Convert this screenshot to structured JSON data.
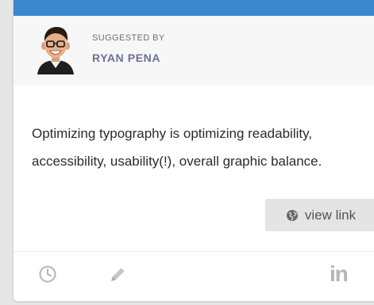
{
  "card": {
    "suggested_label": "SUGGESTED BY",
    "author_name": "RYAN PENA",
    "post_text": "Optimizing typography is optimizing readability, accessibility, usability(!), overall graphic balance.",
    "view_link_label": "view link",
    "linkedin_label": "in"
  },
  "icons": {
    "globe": "globe-icon",
    "clock": "clock-icon",
    "pencil": "pencil-icon",
    "linkedin": "linkedin-icon"
  },
  "colors": {
    "top_bar": "#3a86cf",
    "author": "#6b6f9a",
    "button_bg": "#e4e4e4",
    "icon_gray": "#b5b5b5"
  }
}
